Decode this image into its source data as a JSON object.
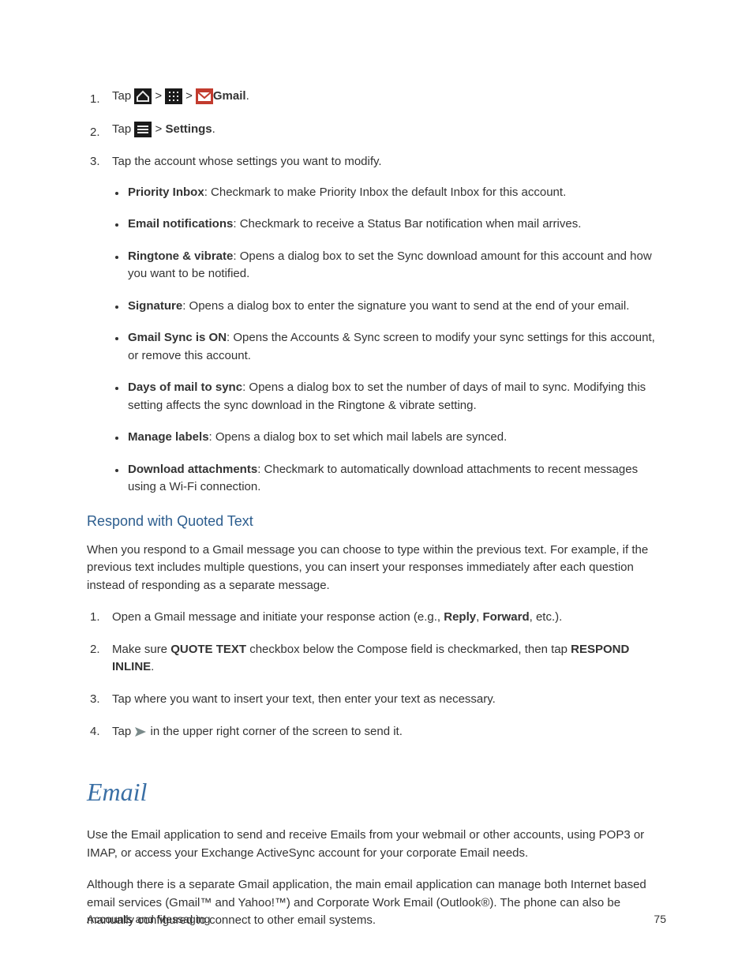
{
  "steps_gmail": {
    "s1_prefix": "Tap ",
    "s1_gmail": "Gmail",
    "s1_suffix": ".",
    "s2_prefix": "Tap ",
    "s2_sep": " > ",
    "s2_settings": "Settings",
    "s2_suffix": ".",
    "s3": "Tap the account whose settings you want to modify."
  },
  "sep_gt": " > ",
  "settings_items": {
    "priority_inbox_label": "Priority Inbox",
    "priority_inbox_text": ": Checkmark to make Priority Inbox the default Inbox for this account.",
    "email_notif_label": "Email notifications",
    "email_notif_text": ": Checkmark to receive a Status Bar notification when mail arrives.",
    "ringtone_label": "Ringtone & vibrate",
    "ringtone_text": ": Opens a dialog box to set the Sync download amount for this account and how you want to be notified.",
    "signature_label": "Signature",
    "signature_text": ": Opens a dialog box to enter the signature you want to send at the end of your email.",
    "gmail_sync_label": "Gmail Sync is ON",
    "gmail_sync_text": ": Opens the Accounts & Sync screen to modify your sync settings for this account, or remove this account.",
    "days_label": "Days of mail to sync",
    "days_text": ": Opens a dialog box to set the number of days of mail to sync. Modifying this setting affects the sync download in the Ringtone & vibrate setting.",
    "labels_label": "Manage labels",
    "labels_text": ": Opens a dialog box to set which mail labels are synced.",
    "download_label": "Download attachments",
    "download_text": ": Checkmark to automatically download attachments to recent messages using a Wi-Fi connection."
  },
  "quoted_heading": "Respond with Quoted Text",
  "quoted_para": "When you respond to a Gmail message you can choose to type within the previous text. For example, if the previous text includes multiple questions, you can insert your responses immediately after each question instead of responding as a separate message.",
  "quoted_steps": {
    "q1_a": "Open a Gmail message and initiate your response action (e.g., ",
    "q1_reply": "Reply",
    "q1_sep": ", ",
    "q1_forward": "Forward",
    "q1_b": ", etc.).",
    "q2_a": "Make sure ",
    "q2_quote": "QUOTE TEXT",
    "q2_b": " checkbox below the Compose field is checkmarked, then tap ",
    "q2_respond": "RESPOND INLINE",
    "q2_c": ".",
    "q3": "Tap where you want to insert your text, then enter your text as necessary.",
    "q4_a": "Tap ",
    "q4_b": " in the upper right corner of the screen to send it."
  },
  "email_heading": "Email",
  "email_para1": "Use the Email application to send and receive Emails from your webmail or other accounts, using POP3 or IMAP, or access your Exchange ActiveSync account for your corporate Email needs.",
  "email_para2": "Although there is a separate Gmail application, the main email application can manage both Internet based email services (Gmail™ and Yahoo!™) and Corporate Work Email (Outlook®). The phone can also be manually configured to connect to other email systems.",
  "footer_left": "Accounts and Messaging",
  "footer_right": "75"
}
